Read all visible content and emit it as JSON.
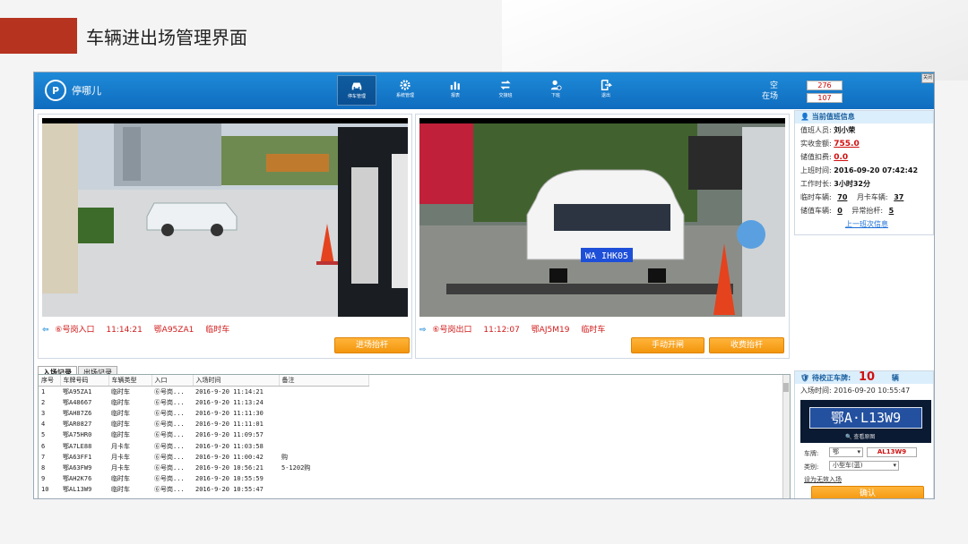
{
  "slide": {
    "title": "车辆进出场管理界面"
  },
  "app": {
    "logo_text": "停哪儿",
    "nav": [
      {
        "label": "停车管理",
        "icon": "car-icon",
        "active": true
      },
      {
        "label": "系统管理",
        "icon": "gear-icon",
        "active": false
      },
      {
        "label": "报表",
        "icon": "bar-chart-icon",
        "active": false
      },
      {
        "label": "交接班",
        "icon": "swap-icon",
        "active": false
      },
      {
        "label": "下班",
        "icon": "user-off-icon",
        "active": false
      },
      {
        "label": "退出",
        "icon": "exit-icon",
        "active": false
      }
    ],
    "stats": {
      "vacant_label": "空",
      "present_label": "在场",
      "vacant_value": "276",
      "present_value": "107"
    },
    "close_label": "关闭"
  },
  "entry_cam": {
    "location": "⑥号岗入口",
    "time": "11:14:21",
    "plate": "鄂A95ZA1",
    "type": "临时车",
    "button": "进场抬杆"
  },
  "exit_cam": {
    "location": "⑥号岗出口",
    "time": "11:12:07",
    "plate": "鄂AJ5M19",
    "type": "临时车",
    "btn_manual": "手动开闸",
    "btn_charge": "收费抬杆",
    "plate_visible": "WA IHK05"
  },
  "duty": {
    "title": "当前值班信息",
    "staff_label": "值班人员:",
    "staff": "刘小荣",
    "received_label": "实收金额:",
    "received": "755.0",
    "deduct_label": "储值扣费:",
    "deduct": "0.0",
    "start_label": "上班时间:",
    "start": "2016-09-20 07:42:42",
    "duration_label": "工作时长:",
    "duration": "3小时32分",
    "temp_label": "临时车辆:",
    "temp": "70",
    "monthly_label": "月卡车辆:",
    "monthly": "37",
    "stored_label": "储值车辆:",
    "stored": "0",
    "abnormal_label": "异常抬杆:",
    "abnormal": "5",
    "prev_shift_link": "上一班次信息"
  },
  "tabs": [
    "入场记录",
    "出场记录"
  ],
  "table": {
    "headers": [
      "序号",
      "车牌号码",
      "车辆类型",
      "入口",
      "入场时间",
      "备注"
    ],
    "rows": [
      [
        "1",
        "鄂A95ZA1",
        "临时车",
        "⑥号岗...",
        "2016-9-20 11:14:21",
        ""
      ],
      [
        "2",
        "鄂A48667",
        "临时车",
        "⑥号岗...",
        "2016-9-20 11:13:24",
        ""
      ],
      [
        "3",
        "鄂AH87Z6",
        "临时车",
        "⑥号岗...",
        "2016-9-20 11:11:30",
        ""
      ],
      [
        "4",
        "鄂AR0827",
        "临时车",
        "⑥号岗...",
        "2016-9-20 11:11:01",
        ""
      ],
      [
        "5",
        "鄂A75HR0",
        "临时车",
        "⑥号岗...",
        "2016-9-20 11:09:57",
        ""
      ],
      [
        "6",
        "鄂A7LE88",
        "月卡车",
        "⑥号岗...",
        "2016-9-20 11:03:58",
        ""
      ],
      [
        "7",
        "鄂A63FF1",
        "月卡车",
        "⑥号岗...",
        "2016-9-20 11:00:42",
        "购"
      ],
      [
        "8",
        "鄂A63FW9",
        "月卡车",
        "⑥号岗...",
        "2016-9-20 10:56:21",
        "5-1202购"
      ],
      [
        "9",
        "鄂AH2K76",
        "临时车",
        "⑥号岗...",
        "2016-9-20 10:55:59",
        ""
      ],
      [
        "10",
        "鄂AL13W9",
        "临时车",
        "⑥号岗...",
        "2016-9-20 10:55:47",
        ""
      ]
    ]
  },
  "correction": {
    "title": "待校正车牌:",
    "count": "10",
    "unit": "辆",
    "entry_time_label": "入场时间:",
    "entry_time": "2016-09-20 10:55:47",
    "plate_image_text": "鄂A·L13W9",
    "view_original": "查看原图",
    "plate_label": "车牌:",
    "province": "鄂",
    "plate_value": "AL13W9",
    "type_label": "类别:",
    "type_value": "小型车(蓝)",
    "invalid_link": "设为无效入场",
    "confirm": "确认"
  }
}
